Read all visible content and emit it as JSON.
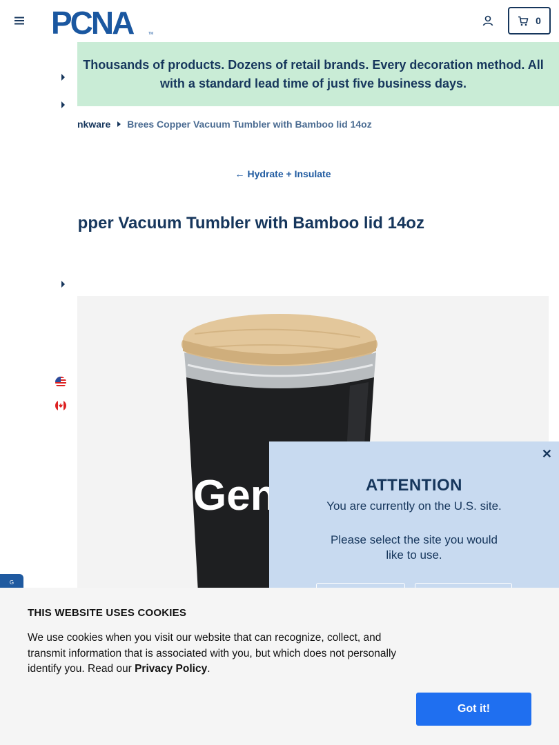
{
  "header": {
    "logo_text": "PCNA",
    "logo_tm": "TM",
    "cart_count": "0"
  },
  "promo": {
    "text": "Thousands of products. Dozens of retail brands. Every decoration method. All with a standard lead time of just five business days."
  },
  "breadcrumb": {
    "parent": "nkware",
    "current": "Brees Copper Vacuum Tumbler with Bamboo lid 14oz"
  },
  "back_link": {
    "label": "Hydrate + Insulate"
  },
  "product": {
    "title": "opper Vacuum Tumbler with Bamboo lid 14oz",
    "imprint_text": "Gen"
  },
  "modal": {
    "title": "ATTENTION",
    "text1": "You are currently on the U.S. site.",
    "text2": "Please select the site you would like to use."
  },
  "cookie": {
    "title": "THIS WEBSITE USES COOKIES",
    "text_before": "We use cookies when you visit our website that can recognize, collect, and transmit information that is associated with you, but which does not personally identify you. Read our ",
    "link": "Privacy Policy",
    "text_after": ".",
    "button": "Got it!"
  },
  "chat_tab": {
    "label": "G"
  },
  "colors": {
    "brand_navy": "#16365c",
    "promo_bg": "#c9ecd6",
    "modal_bg": "#c8daf0",
    "accent_blue": "#1f6ff0"
  }
}
